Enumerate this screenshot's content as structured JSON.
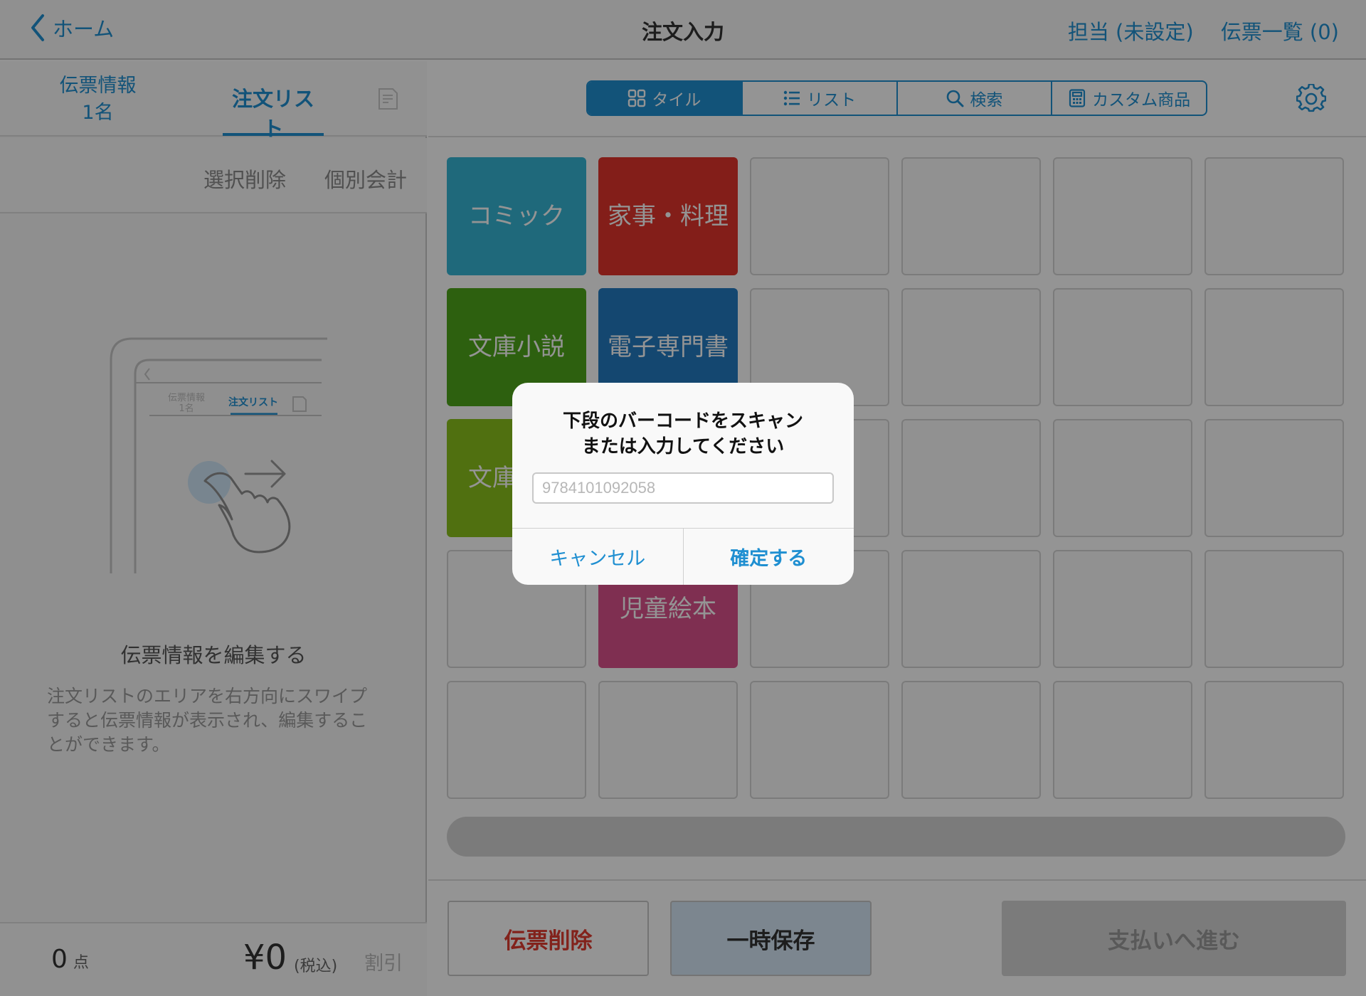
{
  "header": {
    "back_label": "ホーム",
    "title": "注文入力",
    "staff_label": "担当 (未設定)",
    "slips_label": "伝票一覧 (0)"
  },
  "left_panel": {
    "tab_info_line1": "伝票情報",
    "tab_info_line2": "1名",
    "tab_order": "注文リスト",
    "select_delete": "選択削除",
    "split_bill": "個別会計",
    "illustration": {
      "tab_info_line1": "伝票情報",
      "tab_info_line2": "1名",
      "tab_order": "注文リスト"
    },
    "edit_title": "伝票情報を編集する",
    "edit_description": "注文リストのエリアを右方向にスワイプすると伝票情報が表示され、編集することができます。",
    "footer": {
      "count": "0",
      "count_unit": "点",
      "price": "¥0",
      "tax_note": "(税込)",
      "discount": "割引"
    }
  },
  "view_tabs": [
    {
      "label": "タイル",
      "icon": "grid-icon",
      "active": true
    },
    {
      "label": "リスト",
      "icon": "list-icon",
      "active": false
    },
    {
      "label": "検索",
      "icon": "search-icon",
      "active": false
    },
    {
      "label": "カスタム商品",
      "icon": "calculator-icon",
      "active": false
    }
  ],
  "tiles": [
    {
      "label": "コミック",
      "color": "#36b6d4"
    },
    {
      "label": "家事・料理",
      "color": "#e2342b"
    },
    {
      "label": "文庫小説",
      "color": "#4fa51a"
    },
    {
      "label": "電子専門書",
      "color": "#237bc2"
    },
    {
      "label": "文庫小説",
      "color": "#8bc21c"
    },
    {
      "label": "児童絵本",
      "color": "#db518c"
    }
  ],
  "bottom_buttons": {
    "delete": "伝票削除",
    "hold": "一時保存",
    "pay": "支払いへ進む"
  },
  "dialog": {
    "message_line1": "下段のバーコードをスキャン",
    "message_line2": "または入力してください",
    "input_placeholder": "9784101092058",
    "input_value": "",
    "cancel": "キャンセル",
    "confirm": "確定する"
  },
  "colors": {
    "accent": "#1f8fd1",
    "danger": "#e03b30"
  }
}
